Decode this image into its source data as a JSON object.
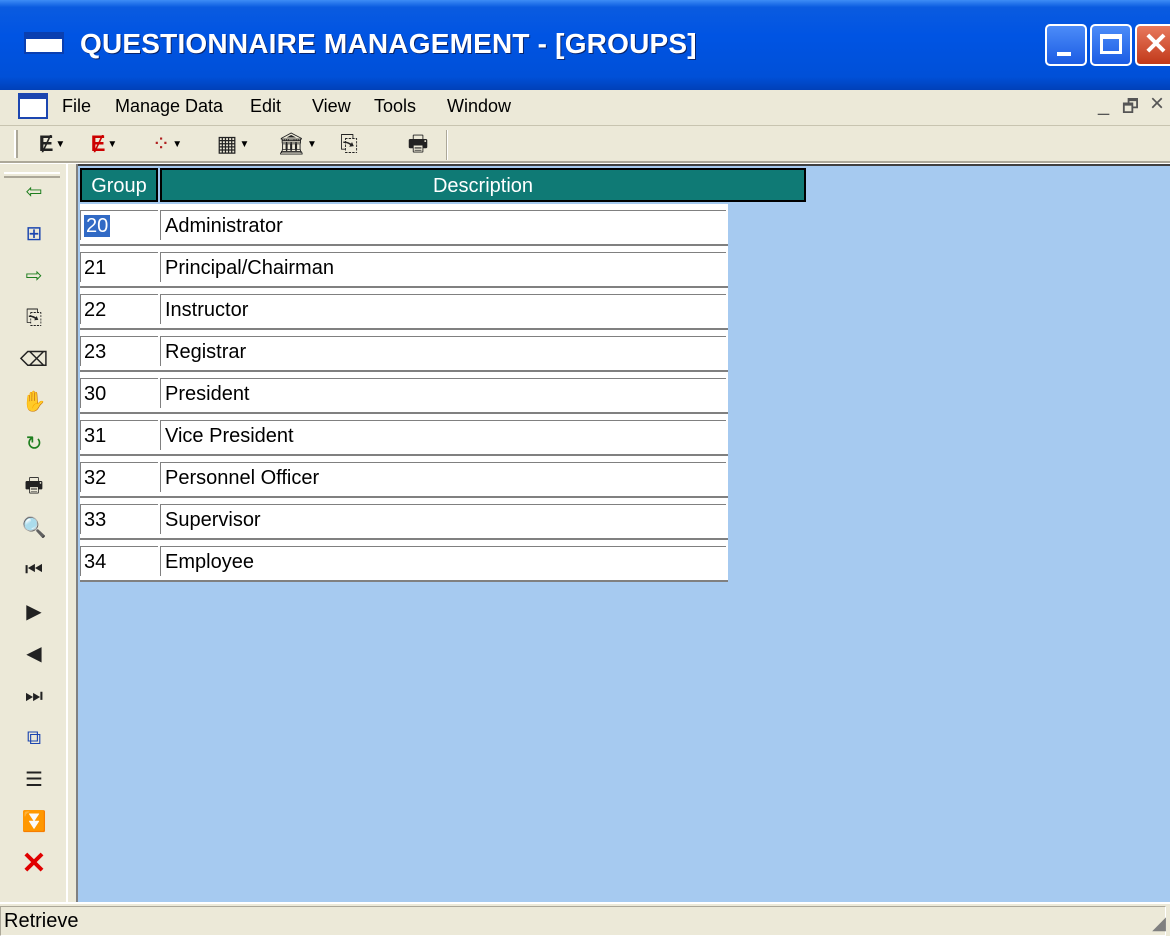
{
  "window": {
    "title": "QUESTIONNAIRE MANAGEMENT - [GROUPS]",
    "caption_buttons": {
      "minimize": "_",
      "maximize": "□",
      "close": "✕"
    }
  },
  "menu": {
    "items": [
      "File",
      "Manage Data",
      "Edit",
      "View",
      "Tools",
      "Window"
    ],
    "mdi_controls": {
      "minimize": "_",
      "restore": "🗗",
      "close": "×"
    }
  },
  "toolbar": {
    "buttons": [
      {
        "icon": "edit-E-icon",
        "glyph": "Ɇ"
      },
      {
        "icon": "query-E-icon",
        "glyph": "Ɇ"
      },
      {
        "icon": "groups-icon",
        "glyph": "⁘"
      },
      {
        "icon": "grid-icon",
        "glyph": "▦"
      },
      {
        "icon": "building-icon",
        "glyph": "🏛"
      },
      {
        "icon": "exit-door-icon",
        "glyph": "⎘"
      },
      {
        "icon": "print-icon",
        "glyph": "🖶"
      }
    ]
  },
  "side_toolbar": {
    "buttons": [
      {
        "icon": "retrieve-icon",
        "glyph": "⇦"
      },
      {
        "icon": "insert-row-icon",
        "glyph": "⊞"
      },
      {
        "icon": "save-icon",
        "glyph": "⇨"
      },
      {
        "icon": "copy-icon",
        "glyph": "⎘"
      },
      {
        "icon": "erase-icon",
        "glyph": "⌫"
      },
      {
        "icon": "hands-icon",
        "glyph": "✋"
      },
      {
        "icon": "refresh-icon",
        "glyph": "↻"
      },
      {
        "icon": "print-icon",
        "glyph": "🖶"
      },
      {
        "icon": "preview-icon",
        "glyph": "🔍"
      },
      {
        "icon": "first-record-icon",
        "glyph": "⏮"
      },
      {
        "icon": "next-record-icon",
        "glyph": "▶"
      },
      {
        "icon": "prior-record-icon",
        "glyph": "◀"
      },
      {
        "icon": "last-record-icon",
        "glyph": "⏭"
      },
      {
        "icon": "cascade-icon",
        "glyph": "⧉"
      },
      {
        "icon": "sort-icon",
        "glyph": "☰"
      },
      {
        "icon": "filter-icon",
        "glyph": "⏬"
      },
      {
        "icon": "close-icon",
        "glyph": "✕"
      }
    ]
  },
  "grid": {
    "columns": [
      "Group",
      "Description"
    ],
    "rows": [
      {
        "group": "20",
        "description": "Administrator"
      },
      {
        "group": "21",
        "description": "Principal/Chairman"
      },
      {
        "group": "22",
        "description": "Instructor"
      },
      {
        "group": "23",
        "description": "Registrar"
      },
      {
        "group": "30",
        "description": "President"
      },
      {
        "group": "31",
        "description": "Vice President"
      },
      {
        "group": "32",
        "description": "Personnel Officer"
      },
      {
        "group": "33",
        "description": "Supervisor"
      },
      {
        "group": "34",
        "description": "Employee"
      }
    ],
    "selected_row": 0
  },
  "status": {
    "text": "Retrieve"
  },
  "colors": {
    "title_bar": "#0054e3",
    "grid_header": "#0f7a75",
    "client_area": "#a6caf0",
    "selection": "#316ac5",
    "close_icon": "#e00000",
    "filter_icon": "#1fa01f"
  }
}
